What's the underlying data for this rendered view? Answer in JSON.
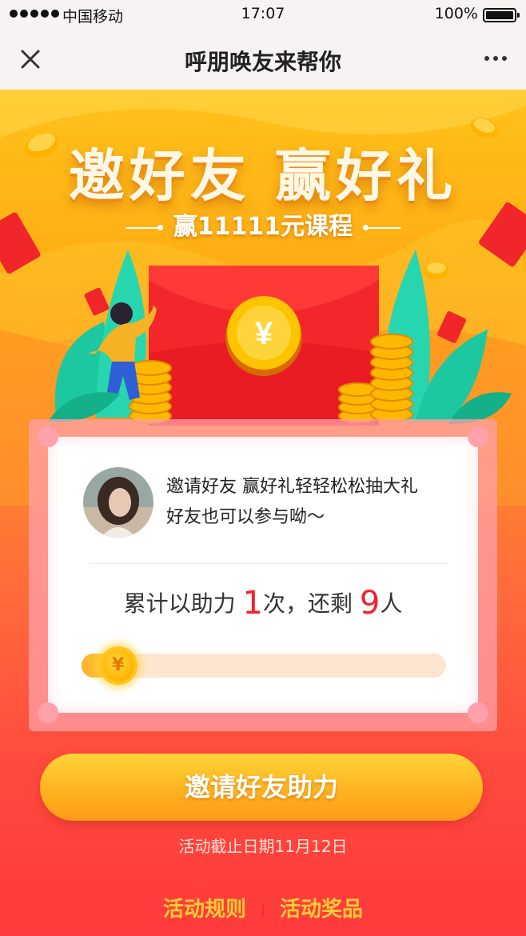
{
  "status_bar": {
    "carrier": "中国移动",
    "time": "17:07",
    "battery": "100%"
  },
  "navbar": {
    "title": "呼朋唤友来帮你"
  },
  "banner": {
    "headline": "邀好友 赢好礼",
    "subline": "赢11111元课程"
  },
  "card": {
    "message_line1": "邀请好友 赢好礼轻轻松松抽大礼",
    "message_line2": "好友也可以参与呦～",
    "count_prefix": "累计以助力 ",
    "helped_count": "1",
    "count_middle": "次，还剩 ",
    "remaining_count": "9",
    "count_suffix": "人",
    "progress_fraction": 0.1,
    "coin_symbol": "¥"
  },
  "cta": {
    "label": "邀请好友助力"
  },
  "deadline": "活动截止日期11月12日",
  "footer_links": {
    "rules": "活动规则",
    "prizes": "活动奖品"
  },
  "colors": {
    "accent_red": "#f5202e",
    "gold": "#ffc21a",
    "link_yellow": "#ffcd36"
  }
}
